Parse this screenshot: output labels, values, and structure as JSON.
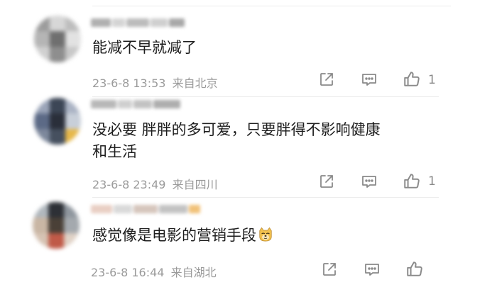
{
  "comments": [
    {
      "text": "能减不早就减了",
      "date": "23-6-8 13:53",
      "location": "来自北京",
      "likes": "1"
    },
    {
      "text_line1": "没必要  胖胖的多可爱，只要胖得不影响健康",
      "text_line2": "和生活",
      "date": "23-6-8 23:49",
      "location": "来自四川",
      "likes": "1"
    },
    {
      "text": "感觉像是电影的营销手段",
      "date": "23-6-8 16:44",
      "location": "来自湖北",
      "likes": ""
    }
  ],
  "colors": {
    "text": "#1d1d1d",
    "meta": "#9a9a9a",
    "icon": "#8a8a8a"
  },
  "icons": [
    "share-icon",
    "comment-icon",
    "like-icon",
    "doge-emoji-icon"
  ]
}
